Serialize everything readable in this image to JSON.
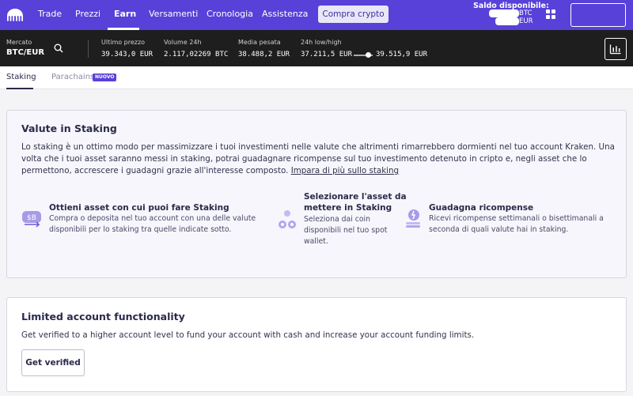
{
  "nav": {
    "items": [
      "Trade",
      "Prezzi",
      "Earn",
      "Versamenti",
      "Cronologia",
      "Assistenza"
    ],
    "buy_label": "Compra crypto",
    "balance_label": "Saldo disponibile:",
    "balance_currencies": [
      "BTC",
      "EUR"
    ]
  },
  "market": {
    "pair_label": "Mercato",
    "pair": "BTC/EUR",
    "last_price_label": "Ultimo prezzo",
    "last_price": "39.343,0 EUR",
    "volume_label": "Volume 24h",
    "volume": "2.117,02269 BTC",
    "avg_label": "Media pesata",
    "avg": "38.488,2 EUR",
    "range_label": "24h low/high",
    "low": "37.211,5 EUR",
    "high": "39.515,9 EUR"
  },
  "tabs": {
    "staking": "Staking",
    "parachains": "Parachains",
    "new_badge": "NUOVO"
  },
  "staking_card": {
    "title": "Valute in Staking",
    "line1": "Lo staking è un ottimo modo per massimizzare i tuoi investimenti nelle valute che altrimenti rimarrebbero dormienti nel tuo account Kraken. Una",
    "line2": "volta che i tuoi asset saranno messi in staking, potrai guadagnare ricompense sul tuo investimento detenuto in cripto e, negli asset che lo",
    "line3": "permettono, accrescere i guadagni grazie all'interesse composto.",
    "link": "Impara di più sullo staking",
    "features": [
      {
        "title": "Ottieni asset con cui puoi fare Staking",
        "desc1": "Compra o deposita nel tuo account con una delle valute",
        "desc2": "disponibili per lo staking tra quelle indicate sotto."
      },
      {
        "title1": "Selezionare l'asset da",
        "title2": "mettere in Staking",
        "desc1": "Seleziona dai coin",
        "desc2": "disponibili nel tuo spot",
        "desc3": "wallet."
      },
      {
        "title": "Guadagna ricompense",
        "desc1": "Ricevi ricompense settimanali o bisettimanali a",
        "desc2": "seconda di quali valute hai in staking."
      }
    ]
  },
  "limited_card": {
    "title": "Limited account functionality",
    "text": "Get verified to a higher account level to fund your account with cash and increase your account funding limits.",
    "button": "Get verified"
  },
  "colors": {
    "brand": "#5741d9",
    "marketbar": "#1e1e1e",
    "accent_light": "#e9e7f7"
  }
}
